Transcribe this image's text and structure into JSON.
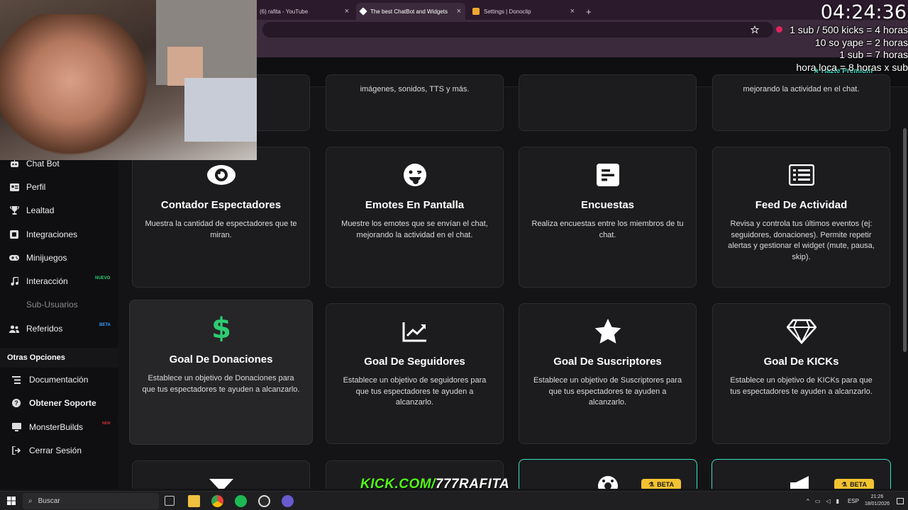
{
  "browser": {
    "tabs": [
      {
        "title": "(6) rafita - YouTube",
        "active": false
      },
      {
        "title": "The best ChatBot and Widgets",
        "active": true
      },
      {
        "title": "Settings | Donoclip",
        "active": false
      }
    ],
    "new_tab": "+",
    "close_glyph": "×"
  },
  "topnav": {
    "premium_label": "Hazte Premium"
  },
  "sidebar": {
    "items": [
      {
        "label": "Chat Bot",
        "icon": "robot-icon"
      },
      {
        "label": "Perfil",
        "icon": "id-card-icon"
      },
      {
        "label": "Lealtad",
        "icon": "trophy-icon"
      },
      {
        "label": "Integraciones",
        "icon": "plug-icon"
      },
      {
        "label": "Minijuegos",
        "icon": "gamepad-icon"
      },
      {
        "label": "Interacción",
        "icon": "music-icon",
        "badge": "NUEVO"
      },
      {
        "label": "Sub-Usuarios",
        "icon": "users-icon"
      },
      {
        "label": "Referidos",
        "icon": "referral-icon",
        "badge": "BETA"
      }
    ],
    "section_title": "Otras Opciones",
    "other_items": [
      {
        "label": "Documentación",
        "icon": "book-icon"
      },
      {
        "label": "Obtener Soporte",
        "icon": "help-icon"
      },
      {
        "label": "MonsterBuilds",
        "icon": "monitor-icon",
        "badge": "NEW"
      },
      {
        "label": "Cerrar Sesión",
        "icon": "logout-icon"
      }
    ]
  },
  "top_partial_cards": [
    {
      "desc": ""
    },
    {
      "desc": "imágenes, sonidos, TTS y más."
    },
    {
      "desc": ""
    },
    {
      "desc": "mejorando la actividad en el chat."
    }
  ],
  "cards": [
    {
      "title": "Contador Espectadores",
      "desc": "Muestra la cantidad de espectadores que te miran.",
      "icon": "eye-icon"
    },
    {
      "title": "Emotes En Pantalla",
      "desc": "Muestre los emotes que se envían el chat, mejorando la actividad en el chat.",
      "icon": "emoji-icon"
    },
    {
      "title": "Encuestas",
      "desc": "Realiza encuestas entre los miembros de tu chat.",
      "icon": "poll-icon"
    },
    {
      "title": "Feed De Actividad",
      "desc": "Revisa y controla tus últimos eventos (ej: seguidores, donaciones). Permite repetir alertas y gestionar el widget (mute, pausa, skip).",
      "icon": "list-icon"
    },
    {
      "title": "Goal De Donaciones",
      "desc": "Establece un objetivo de Donaciones para que tus espectadores te ayuden a alcanzarlo.",
      "icon": "dollar-icon"
    },
    {
      "title": "Goal De Seguidores",
      "desc": "Establece un objetivo de seguidores para que tus espectadores te ayuden a alcanzarlo.",
      "icon": "chart-line-icon"
    },
    {
      "title": "Goal De Suscriptores",
      "desc": "Establece un objetivo de Suscriptores para que tus espectadores te ayuden a alcanzarlo.",
      "icon": "star-icon"
    },
    {
      "title": "Goal De KICKs",
      "desc": "Establece un objetivo de KICKs para que tus espectadores te ayuden a alcanzarlo.",
      "icon": "diamond-icon"
    }
  ],
  "bottom_cards": [
    {
      "icon": "filter-icon",
      "badge": ""
    },
    {
      "icon": "car-icon",
      "badge": ""
    },
    {
      "icon": "gear-icon",
      "badge": "BETA"
    },
    {
      "icon": "megaphone-icon",
      "badge": "BETA"
    }
  ],
  "stream_overlay": {
    "timer": "04:24:36",
    "lines": [
      "1 sub / 500 kicks = 4 horas",
      "10 so yape = 2 horas",
      "1 sub = 7 horas",
      "hora loca = 8 horas x sub"
    ],
    "watermark_site": "KICK.COM/",
    "watermark_user": "777RAFITA"
  },
  "taskbar": {
    "search_label": "Buscar",
    "lang": "ESP",
    "time": "21:26",
    "date": "18/01/2026"
  },
  "colors": {
    "accent": "#39e2c5",
    "dollar": "#2ecc71",
    "beta": "#f2c230",
    "badge_new": "#2ecc71",
    "badge_beta": "#3aa0ff"
  }
}
